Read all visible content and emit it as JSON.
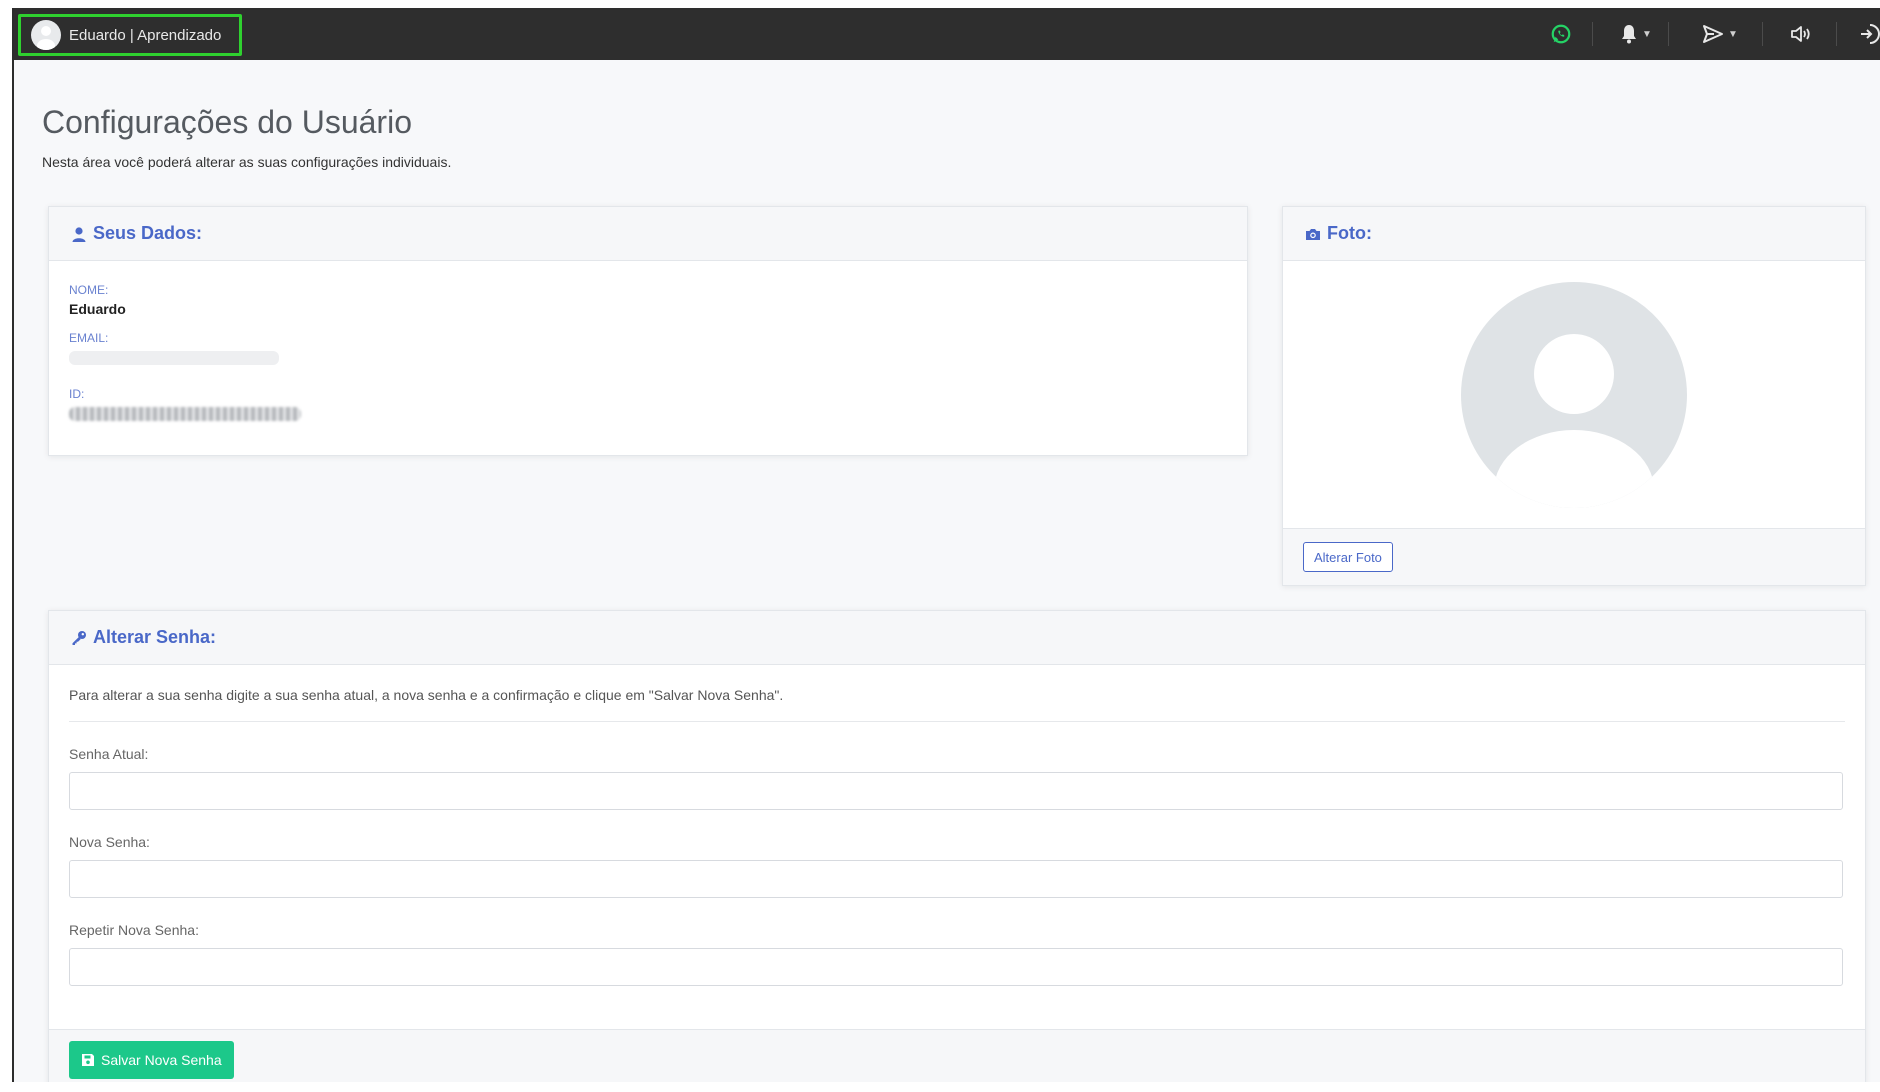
{
  "topbar": {
    "user_label": "Eduardo | Aprendizado",
    "icons": [
      "whatsapp-icon",
      "bell-icon",
      "send-icon",
      "speaker-icon",
      "logout-icon"
    ],
    "colors": {
      "bar": "#2e2e2e",
      "highlight": "#2fd12f",
      "whatsapp": "#25d366"
    }
  },
  "page": {
    "title": "Configurações do Usuário",
    "subtitle": "Nesta área você poderá alterar as suas configurações individuais."
  },
  "seus_dados": {
    "title": "Seus Dados:",
    "nome_label": "NOME:",
    "nome_value": "Eduardo",
    "email_label": "EMAIL:",
    "id_label": "ID:"
  },
  "foto": {
    "title": "Foto:",
    "button_label": "Alterar Foto"
  },
  "senha": {
    "title": "Alterar Senha:",
    "help": "Para alterar a sua senha digite a sua senha atual, a nova senha e a confirmação e clique em \"Salvar Nova Senha\".",
    "current_label": "Senha Atual:",
    "new_label": "Nova Senha:",
    "repeat_label": "Repetir Nova Senha:",
    "save_label": "Salvar Nova Senha"
  },
  "accent": "#4a68c8",
  "success": "#1cc88a"
}
